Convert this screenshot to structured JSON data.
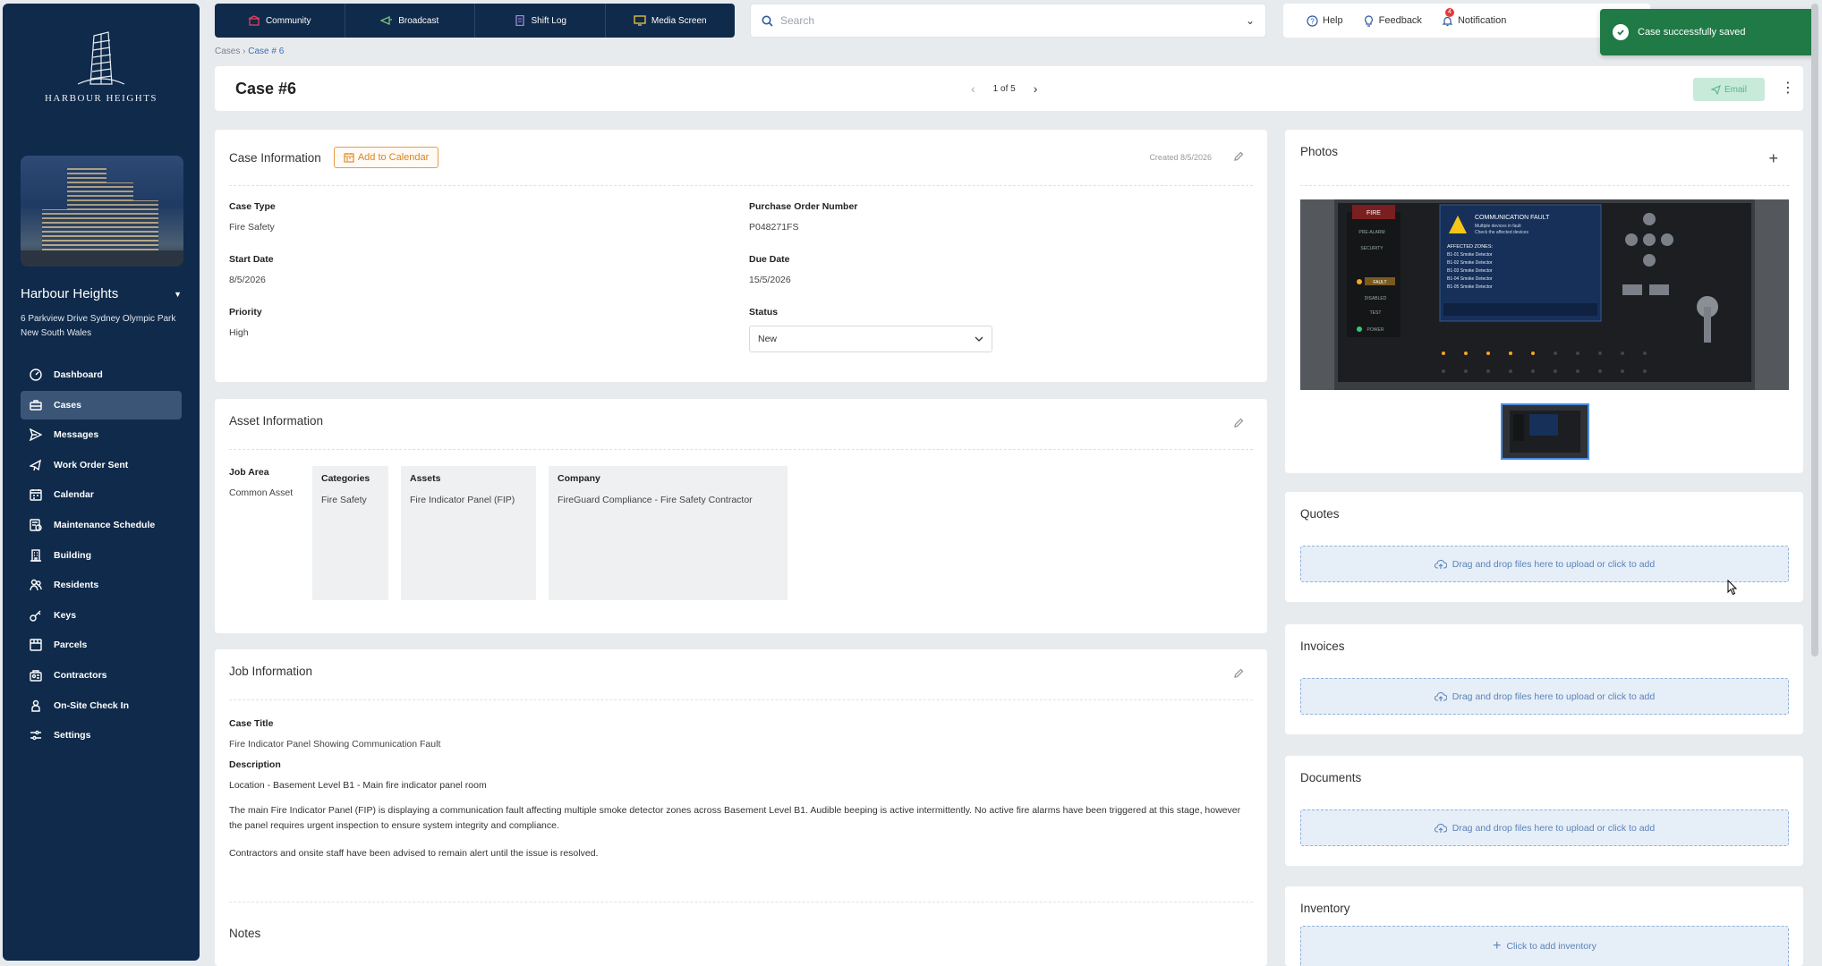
{
  "sidebar": {
    "logo_text": "HARBOUR HEIGHTS",
    "property_name": "Harbour Heights",
    "address": "6 Parkview Drive Sydney Olympic Park New South Wales",
    "items": [
      {
        "label": "Dashboard",
        "icon": "dashboard-icon"
      },
      {
        "label": "Cases",
        "icon": "briefcase-icon",
        "active": true
      },
      {
        "label": "Messages",
        "icon": "send-icon"
      },
      {
        "label": "Work Order Sent",
        "icon": "megaphone-icon"
      },
      {
        "label": "Calendar",
        "icon": "calendar-icon"
      },
      {
        "label": "Maintenance Schedule",
        "icon": "schedule-icon"
      },
      {
        "label": "Building",
        "icon": "building-icon"
      },
      {
        "label": "Residents",
        "icon": "residents-icon"
      },
      {
        "label": "Keys",
        "icon": "key-icon"
      },
      {
        "label": "Parcels",
        "icon": "parcel-icon"
      },
      {
        "label": "Contractors",
        "icon": "contractor-icon"
      },
      {
        "label": "On-Site Check In",
        "icon": "checkin-icon"
      },
      {
        "label": "Settings",
        "icon": "settings-icon"
      }
    ]
  },
  "topnav": {
    "items": [
      {
        "label": "Community",
        "icon": "community-icon"
      },
      {
        "label": "Broadcast",
        "icon": "broadcast-icon"
      },
      {
        "label": "Shift Log",
        "icon": "shiftlog-icon"
      },
      {
        "label": "Media Screen",
        "icon": "monitor-icon"
      }
    ],
    "search_placeholder": "Search",
    "help": "Help",
    "feedback": "Feedback",
    "notification": "Notification",
    "notification_count": "4"
  },
  "toast": {
    "message": "Case successfully saved"
  },
  "breadcrumb": {
    "root": "Cases",
    "current": "Case # 6"
  },
  "case": {
    "title": "Case #6",
    "pager": "1 of 5",
    "email_label": "Email"
  },
  "case_info": {
    "title": "Case Information",
    "calendar_button": "Add to Calendar",
    "created": "Created 8/5/2026",
    "case_type_label": "Case Type",
    "case_type": "Fire Safety",
    "po_label": "Purchase Order Number",
    "po": "P048271FS",
    "start_label": "Start Date",
    "start": "8/5/2026",
    "due_label": "Due Date",
    "due": "15/5/2026",
    "priority_label": "Priority",
    "priority": "High",
    "status_label": "Status",
    "status": "New"
  },
  "asset_info": {
    "title": "Asset Information",
    "job_area_label": "Job Area",
    "job_area": "Common Asset",
    "categories_label": "Categories",
    "categories": "Fire Safety",
    "assets_label": "Assets",
    "assets": "Fire Indicator Panel (FIP)",
    "company_label": "Company",
    "company": "FireGuard Compliance - Fire Safety Contractor"
  },
  "job_info": {
    "title": "Job Information",
    "case_title_label": "Case Title",
    "case_title": "Fire Indicator Panel Showing Communication Fault",
    "description_label": "Description",
    "location": "Location - Basement Level B1 - Main fire indicator panel room",
    "para1": "The main Fire Indicator Panel (FIP) is displaying a communication fault affecting multiple smoke detector zones across Basement Level B1. Audible beeping is active intermittently. No active fire alarms have been triggered at this stage, however the panel requires urgent inspection to ensure system integrity and compliance.",
    "para2": "Contractors and onsite staff have been advised to remain alert until the issue is resolved.",
    "notes_label": "Notes"
  },
  "photos": {
    "title": "Photos"
  },
  "quotes": {
    "title": "Quotes",
    "drop_text": "Drag and drop files here to upload or click to add"
  },
  "invoices": {
    "title": "Invoices",
    "drop_text": "Drag and drop files here to upload or click to add"
  },
  "documents": {
    "title": "Documents",
    "drop_text": "Drag and drop files here to upload or click to add"
  },
  "inventory": {
    "title": "Inventory",
    "add_text": "Click to add inventory"
  },
  "panel_screen": {
    "heading": "COMMUNICATION FAULT",
    "sub1": "Multiple devices in fault",
    "sub2": "Check the affected devices",
    "zones_label": "AFFECTED ZONES:",
    "zones": [
      "B1-01 Smoke Detector",
      "B1-02 Smoke Detector",
      "B1-03 Smoke Detector",
      "B1-04 Smoke Detector",
      "B1-05 Smoke Detector"
    ],
    "left_labels": [
      "FIRE",
      "PRE-ALARM",
      "SECURITY",
      "FAULT",
      "DISABLED",
      "TEST",
      "POWER"
    ]
  },
  "colors": {
    "sidebar": "#0f2a4a",
    "accent": "#3b6fb6",
    "toast": "#1f7a45",
    "calendar_orange": "#d98426"
  }
}
